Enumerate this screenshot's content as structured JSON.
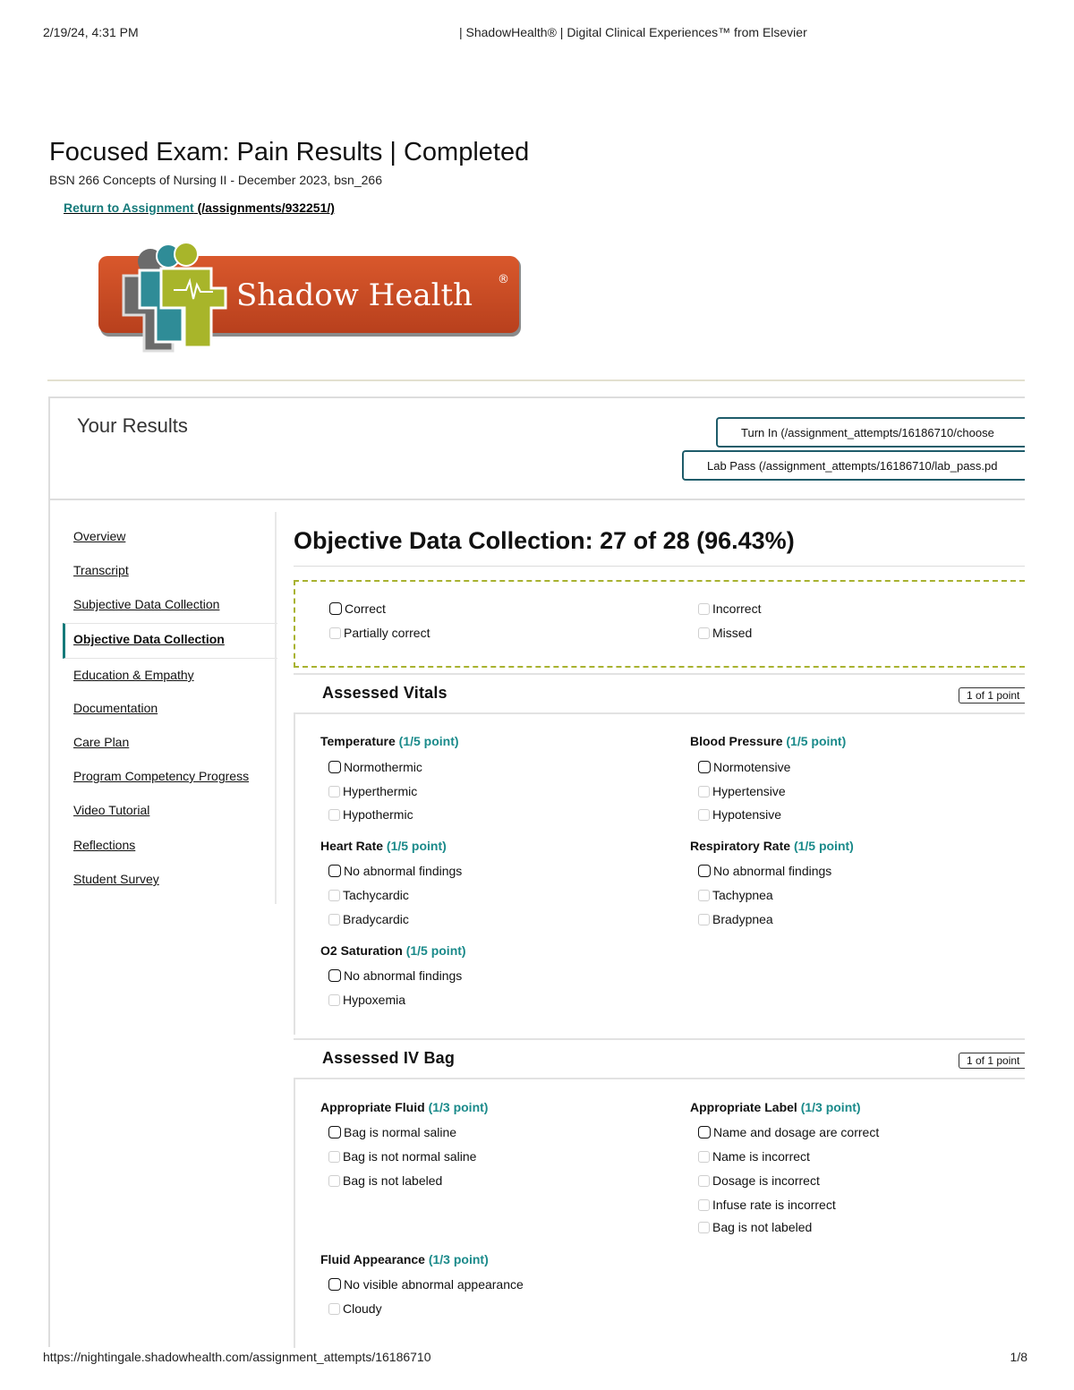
{
  "print_header": {
    "date": "2/19/24, 4:31 PM",
    "title": "| ShadowHealth® | Digital Clinical Experiences™ from Elsevier"
  },
  "print_footer": {
    "url": "https://nightingale.shadowhealth.com/assignment_attempts/16186710",
    "page": "1/8"
  },
  "page": {
    "title": "Focused Exam: Pain Results | Completed",
    "subtitle": "BSN 266 Concepts of Nursing II - December 2023, bsn_266",
    "return_link_text": "Return to Assignment",
    "return_link_path": " (/assignments/932251/)"
  },
  "logo": {
    "text": "Shadow Health",
    "icon": "shadow-health-logo",
    "brand_color": "#c64a24",
    "figure_color": "#a8b52a"
  },
  "results": {
    "title": "Your Results",
    "turn_in_label": "Turn In (/assignment_attempts/16186710/choose",
    "lab_pass_label": "Lab Pass (/assignment_attempts/16186710/lab_pass.pd"
  },
  "nav": {
    "items": [
      "Overview",
      "Transcript",
      "Subjective Data Collection",
      "Objective Data Collection",
      "Education & Empathy",
      "Documentation",
      "Care Plan",
      "Program Competency Progress",
      "Video Tutorial",
      "Reflections",
      "Student Survey"
    ],
    "active_index": 3
  },
  "main": {
    "heading": "Objective Data Collection: 27 of 28 (96.43%)",
    "legend": {
      "correct": "Correct",
      "partially_correct": "Partially correct",
      "incorrect": "Incorrect",
      "missed": "Missed"
    }
  },
  "sections": {
    "vitals": {
      "title": "Assessed Vitals",
      "points": "1 of 1 point",
      "temperature": {
        "label": "Temperature",
        "points": "(1/5 point)",
        "options": [
          "Normothermic",
          "Hyperthermic",
          "Hypothermic"
        ]
      },
      "blood_pressure": {
        "label": "Blood Pressure",
        "points": "(1/5 point)",
        "options": [
          "Normotensive",
          "Hypertensive",
          "Hypotensive"
        ]
      },
      "heart_rate": {
        "label": "Heart Rate",
        "points": "(1/5 point)",
        "options": [
          "No abnormal findings",
          "Tachycardic",
          "Bradycardic"
        ]
      },
      "respiratory_rate": {
        "label": "Respiratory Rate",
        "points": "(1/5 point)",
        "options": [
          "No abnormal findings",
          "Tachypnea",
          "Bradypnea"
        ]
      },
      "o2_saturation": {
        "label": "O2 Saturation",
        "points": "(1/5 point)",
        "options": [
          "No abnormal findings",
          "Hypoxemia"
        ]
      }
    },
    "iv_bag": {
      "title": "Assessed IV Bag",
      "points": "1 of 1 point",
      "appropriate_fluid": {
        "label": "Appropriate Fluid",
        "points": "(1/3 point)",
        "options": [
          "Bag is normal saline",
          "Bag is not normal saline",
          "Bag is not labeled"
        ]
      },
      "appropriate_label": {
        "label": "Appropriate Label",
        "points": "(1/3 point)",
        "options": [
          "Name and dosage are correct",
          "Name is incorrect",
          "Dosage is incorrect",
          "Infuse rate is incorrect",
          "Bag is not labeled"
        ]
      },
      "fluid_appearance": {
        "label": "Fluid Appearance",
        "points": "(1/3 point)",
        "options": [
          "No visible abnormal appearance",
          "Cloudy"
        ]
      }
    }
  }
}
